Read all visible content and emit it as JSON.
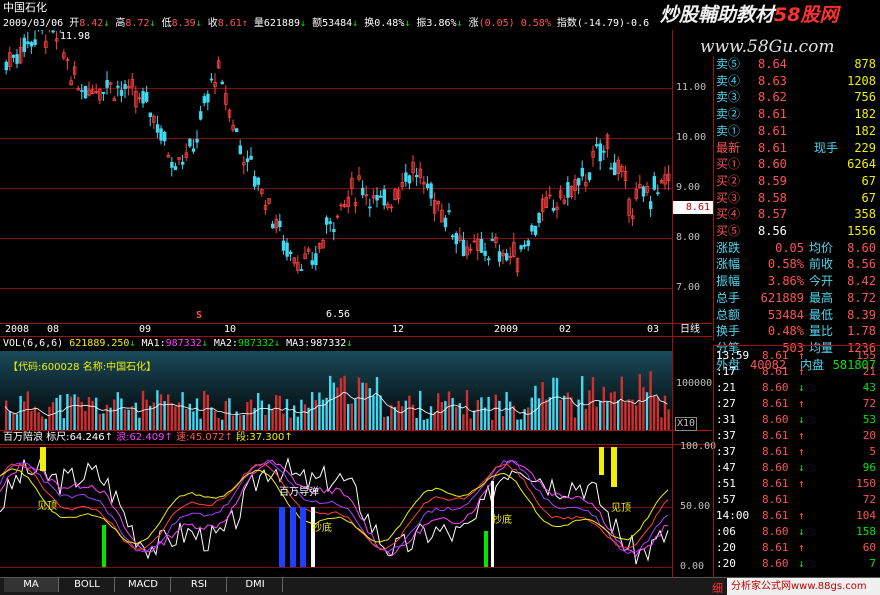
{
  "stock": {
    "name": "中国石化",
    "code": "600028"
  },
  "header": {
    "date": "2009/03/06",
    "open_label": "开",
    "open": "8.42",
    "high_label": "高",
    "high": "8.72",
    "low_label": "低",
    "low": "8.39",
    "close_label": "收",
    "close": "8.61",
    "volume_label": "量",
    "volume": "621889",
    "amount_label": "额",
    "amount": "53484",
    "turnover_label": "换",
    "turnover": "0.48%",
    "amplitude_label": "振",
    "amplitude": "3.86%",
    "change_label": "涨",
    "change": "(0.05)",
    "change_pct": "0.58%",
    "index_label": "指数",
    "index": "(-14.79)-0.6"
  },
  "watermark": {
    "title": "炒股輔助教材",
    "brand": "58股网",
    "url": "www.58Gu.com"
  },
  "price_chart": {
    "y_ticks": [
      "11.00",
      "10.00",
      "9.00",
      "8.00",
      "7.00"
    ],
    "high_label": "11.98",
    "low_label": "6.56",
    "current_price_tag": "8.61",
    "s_marker": "S",
    "x_labels": [
      "2008",
      "08",
      "09",
      "10",
      "12",
      "2009",
      "02",
      "03"
    ],
    "period": "日线"
  },
  "order_book": {
    "asks": [
      {
        "label": "卖⑤",
        "price": "8.64",
        "vol": "878"
      },
      {
        "label": "卖④",
        "price": "8.63",
        "vol": "1208"
      },
      {
        "label": "卖③",
        "price": "8.62",
        "vol": "756"
      },
      {
        "label": "卖②",
        "price": "8.61",
        "vol": "182"
      },
      {
        "label": "卖①",
        "price": "8.61",
        "vol": "182"
      }
    ],
    "last": {
      "label": "最新",
      "price": "8.61",
      "now_label": "现手",
      "now": "229"
    },
    "bids": [
      {
        "label": "买①",
        "price": "8.60",
        "vol": "6264"
      },
      {
        "label": "买②",
        "price": "8.59",
        "vol": "67"
      },
      {
        "label": "买③",
        "price": "8.58",
        "vol": "67"
      },
      {
        "label": "买④",
        "price": "8.57",
        "vol": "358"
      },
      {
        "label": "买⑤",
        "price": "8.56",
        "vol": "1556"
      }
    ],
    "stats": [
      {
        "l1": "涨跌",
        "v1": "0.05",
        "l2": "均价",
        "v2": "8.60"
      },
      {
        "l1": "涨幅",
        "v1": "0.58%",
        "l2": "前收",
        "v2": "8.56"
      },
      {
        "l1": "振幅",
        "v1": "3.86%",
        "l2": "今开",
        "v2": "8.42"
      },
      {
        "l1": "总手",
        "v1": "621889",
        "l2": "最高",
        "v2": "8.72"
      },
      {
        "l1": "总额",
        "v1": "53484",
        "l2": "最低",
        "v2": "8.39"
      },
      {
        "l1": "换手",
        "v1": "0.48%",
        "l2": "量比",
        "v2": "1.78"
      },
      {
        "l1": "分笔",
        "v1": "503",
        "l2": "均量",
        "v2": "1236"
      }
    ],
    "outer_label": "外盘",
    "outer": "40082",
    "inner_label": "内盘",
    "inner": "581807"
  },
  "ticks": [
    {
      "time": "13:59",
      "price": "8.61",
      "arrow": "↑",
      "vol": "155",
      "c": "red"
    },
    {
      "time": ":17",
      "price": "8.61",
      "arrow": "↑",
      "vol": "21",
      "c": "red"
    },
    {
      "time": ":21",
      "price": "8.60",
      "arrow": "↓",
      "vol": "43",
      "c": "green"
    },
    {
      "time": ":27",
      "price": "8.61",
      "arrow": "↑",
      "vol": "72",
      "c": "red"
    },
    {
      "time": ":31",
      "price": "8.60",
      "arrow": "↓",
      "vol": "53",
      "c": "green"
    },
    {
      "time": ":37",
      "price": "8.61",
      "arrow": "↑",
      "vol": "20",
      "c": "red"
    },
    {
      "time": ":37",
      "price": "8.61",
      "arrow": "↑",
      "vol": "5",
      "c": "red"
    },
    {
      "time": ":47",
      "price": "8.60",
      "arrow": "↓",
      "vol": "96",
      "c": "green"
    },
    {
      "time": ":51",
      "price": "8.61",
      "arrow": "↑",
      "vol": "150",
      "c": "red"
    },
    {
      "time": ":57",
      "price": "8.61",
      "arrow": "",
      "vol": "72",
      "c": "red"
    },
    {
      "time": "14:00",
      "price": "8.61",
      "arrow": "↑",
      "vol": "104",
      "c": "red"
    },
    {
      "time": ":06",
      "price": "8.60",
      "arrow": "↓",
      "vol": "158",
      "c": "green"
    },
    {
      "time": ":20",
      "price": "8.61",
      "arrow": "↑",
      "vol": "60",
      "c": "red"
    },
    {
      "time": ":20",
      "price": "8.60",
      "arrow": "↓",
      "vol": "7",
      "c": "green"
    }
  ],
  "volume_panel": {
    "vol_label": "VOL(6,6,6)",
    "vol_value": "621889.250",
    "ma1_label": "MA1:",
    "ma1": "987332",
    "ma2_label": "MA2:",
    "ma2": "987332",
    "ma3_label": "MA3:",
    "ma3": "987332",
    "info": "【代码:600028 名称:中国石化】",
    "y_tick": "100000",
    "unit": "X10"
  },
  "indicator_panel": {
    "name": "百万陪浪",
    "ruler_label": "标尺:",
    "ruler": "64.246",
    "wave_label": "浪:",
    "wave": "62.409",
    "speed_label": "速:",
    "speed": "45.072",
    "segment_label": "段:",
    "segment": "37.300",
    "y_ticks": [
      "100.00",
      "50.00",
      "0.00"
    ],
    "annotations": [
      "见顶",
      "百万导弹",
      "抄底",
      "抄底",
      "见顶"
    ]
  },
  "tabs": [
    "MA",
    "BOLL",
    "MACD",
    "RSI",
    "DMI"
  ],
  "footer_brand": "分析家公式网www.88gs.com",
  "footer_corner": "细"
}
